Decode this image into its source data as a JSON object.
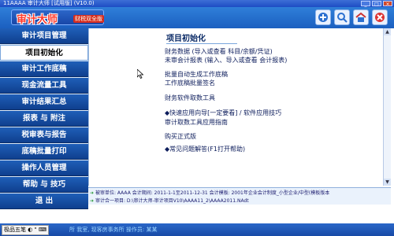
{
  "window": {
    "title": "11AAAA  审计大师 [试用版] (V10.0)",
    "buttons": [
      "_",
      "□",
      "×"
    ]
  },
  "header": {
    "brand": "审计大师",
    "edition_badge": "财税双全版",
    "tool_icons": [
      "add-icon",
      "search-icon",
      "home-icon",
      "close-icon"
    ]
  },
  "menu": {
    "items": [
      {
        "label": "审计项目管理"
      },
      {
        "label": "项目初始化"
      },
      {
        "label": "审计工作底稿"
      },
      {
        "label": "现金流量工具"
      },
      {
        "label": "审计结果汇总"
      },
      {
        "label": "报表 与 附注"
      },
      {
        "label": "税审表与报告"
      },
      {
        "label": "底稿批量打印"
      },
      {
        "label": "操作人员管理"
      },
      {
        "label": "帮助 与 技巧"
      },
      {
        "label": "退    出"
      }
    ]
  },
  "main": {
    "title": "项目初始化",
    "lines": [
      "财务数据   (导入或查看 科目/余额/凭证)",
      "未审会计报表 (输入、导入或查看 会计报表)",
      "批量自动生成工作底稿",
      "工作底稿批量签名",
      "财务软件取数工具",
      "◆快速应用向导[一定要看] / 软件应用技巧",
      "审计取数工具应用指南",
      "购买正式版",
      "◆常见问题解答(F1打开帮助)"
    ]
  },
  "info": {
    "row1": "被审单位: AAAA  会计期间: 2011-1-1至2011-12-31  会计模板: 2001年企业会计制度_小型企业/中型(模板版本",
    "row2": "审计合一项目: D:\\审计大师-审计项目V10\\AAAA11_2\\AAAA2011.NAdt"
  },
  "status": {
    "ime": "极品五笔 ◐ \" ⌨",
    "text": "所  我室, 现客房事务所  操作员: 某某"
  }
}
